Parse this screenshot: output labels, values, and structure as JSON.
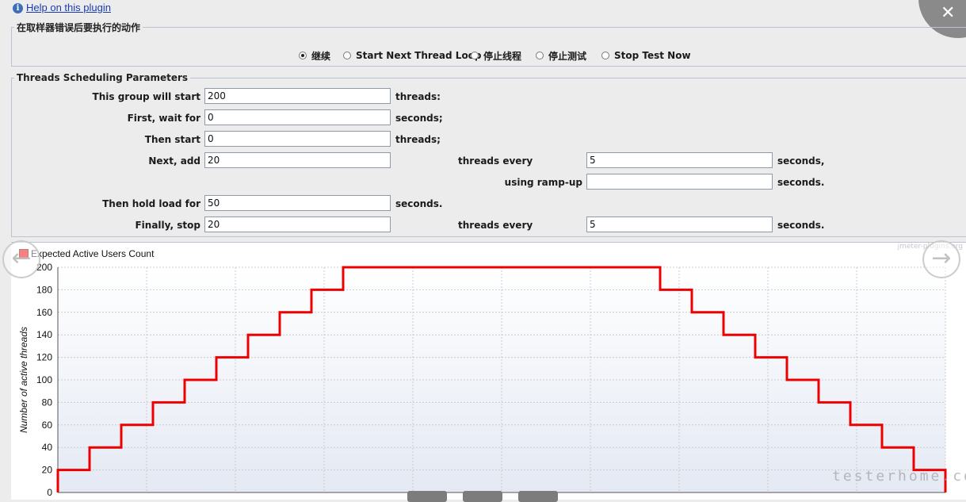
{
  "help": {
    "link_text": "Help on this plugin"
  },
  "error_action": {
    "legend": "在取样器错误后要执行的动作",
    "options": [
      {
        "label": "继续",
        "selected": true
      },
      {
        "label": "Start Next Thread Loop",
        "selected": false
      },
      {
        "label": "停止线程",
        "selected": false
      },
      {
        "label": "停止测试",
        "selected": false
      },
      {
        "label": "Stop Test Now",
        "selected": false
      }
    ]
  },
  "scheduling": {
    "legend": "Threads Scheduling Parameters",
    "start_label": "This group will start",
    "start_value": "200",
    "start_unit": "threads:",
    "wait_label": "First, wait for",
    "wait_value": "0",
    "wait_unit": "seconds;",
    "then_label": "Then start",
    "then_value": "0",
    "then_unit": "threads;",
    "next_label": "Next, add",
    "next_value": "20",
    "next_mid": "threads every",
    "next_every_value": "5",
    "next_unit": "seconds,",
    "ramp_label": "using ramp-up",
    "ramp_value": "",
    "ramp_unit": "seconds.",
    "hold_label": "Then hold load for",
    "hold_value": "50",
    "hold_unit": "seconds.",
    "stop_label": "Finally, stop",
    "stop_value": "20",
    "stop_mid": "threads every",
    "stop_every_value": "5",
    "stop_unit": "seconds."
  },
  "branding": {
    "site": "jmeter-plugins.org",
    "watermark": "testerhome.com"
  },
  "chart_data": {
    "type": "line",
    "title": "",
    "ylabel": "Number of active threads",
    "xlabel": "",
    "ylim": [
      0,
      200
    ],
    "yticks": [
      0,
      20,
      40,
      60,
      80,
      100,
      120,
      140,
      160,
      180,
      200
    ],
    "grid": true,
    "legend": "top-left",
    "series": [
      {
        "name": "Expected Active Users Count",
        "color": "#ee0000",
        "x": [
          0,
          5,
          10,
          15,
          20,
          25,
          30,
          35,
          40,
          45,
          95,
          100,
          105,
          110,
          115,
          120,
          125,
          130,
          135,
          140,
          140
        ],
        "y": [
          20,
          40,
          60,
          80,
          100,
          120,
          140,
          160,
          180,
          200,
          180,
          160,
          140,
          120,
          100,
          80,
          60,
          40,
          20,
          0,
          0
        ]
      }
    ],
    "xlim": [
      0,
      140
    ]
  }
}
